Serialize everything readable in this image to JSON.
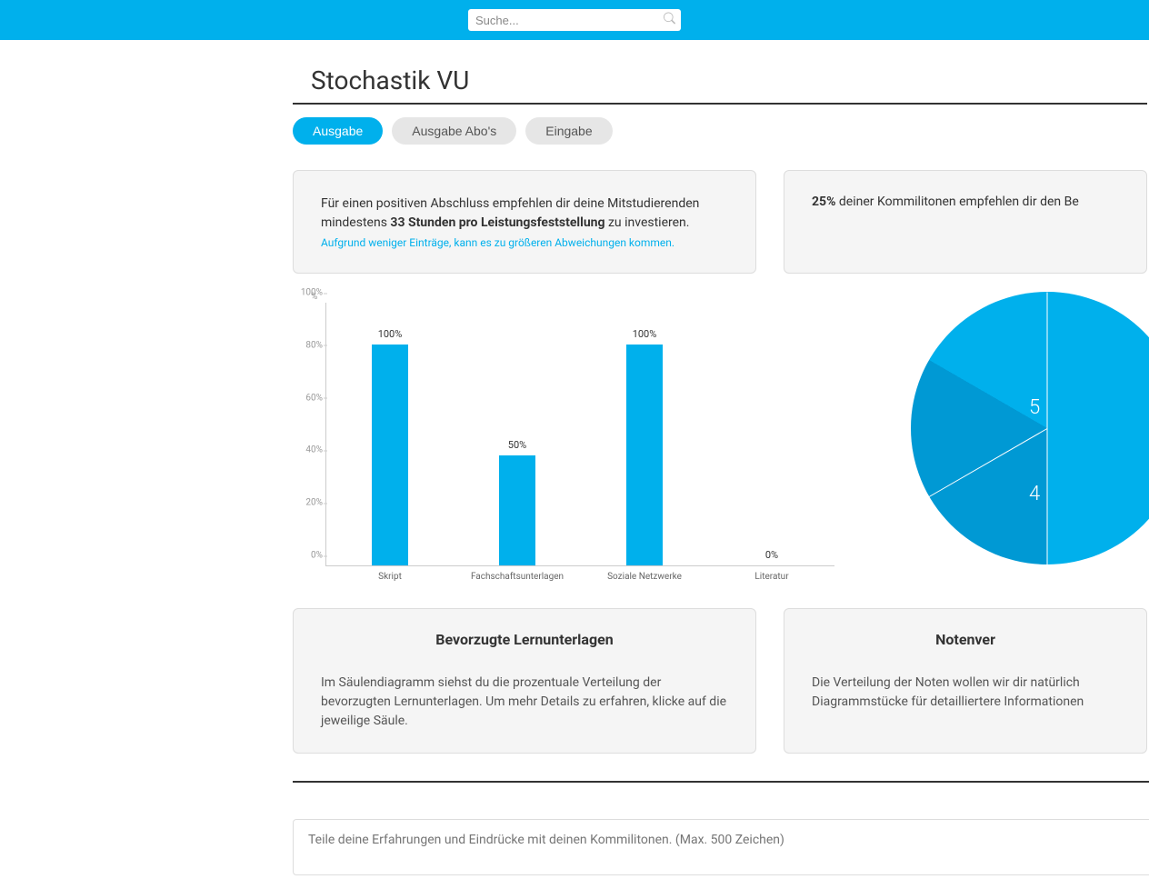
{
  "search": {
    "placeholder": "Suche..."
  },
  "page_title": "Stochastik VU",
  "tabs": [
    {
      "label": "Ausgabe",
      "active": true
    },
    {
      "label": "Ausgabe Abo's",
      "active": false
    },
    {
      "label": "Eingabe",
      "active": false
    }
  ],
  "rec_box": {
    "prefix": "Für einen positiven Abschluss empfehlen dir deine Mitstudierenden mindestens ",
    "bold": "33 Stunden pro Leistungsfeststellung",
    "suffix": " zu investieren.",
    "note": "Aufgrund weniger Einträge, kann es zu größeren Abweichungen kommen."
  },
  "rec_right": {
    "bold": "25%",
    "text": " deiner Kommilitonen empfehlen dir den Be"
  },
  "chart_data": {
    "type": "bar",
    "ylabel": "%",
    "ylim": [
      0,
      100
    ],
    "yticks": [
      "0%",
      "20%",
      "40%",
      "60%",
      "80%",
      "100%"
    ],
    "categories": [
      "Skript",
      "Fachschaftsunterlagen",
      "Soziale Netzwerke",
      "Literatur"
    ],
    "values": [
      100,
      50,
      100,
      0
    ],
    "value_labels": [
      "100%",
      "50%",
      "100%",
      "0%"
    ]
  },
  "pie_data": {
    "type": "pie",
    "visible_labels": [
      "5",
      "4"
    ]
  },
  "desc_left": {
    "title": "Bevorzugte Lernunterlagen",
    "text": "Im Säulendiagramm siehst du die prozentuale Verteilung der bevorzugten Lernunterlagen. Um mehr Details zu erfahren, klicke auf die jeweilige Säule."
  },
  "desc_right": {
    "title": "Notenver",
    "text": "Die Verteilung der Noten wollen wir dir natürlich Diagrammstücke für detailliertere Informationen"
  },
  "feedback": {
    "placeholder": "Teile deine Erfahrungen und Eindrücke mit deinen Kommilitonen. (Max. 500 Zeichen)"
  }
}
